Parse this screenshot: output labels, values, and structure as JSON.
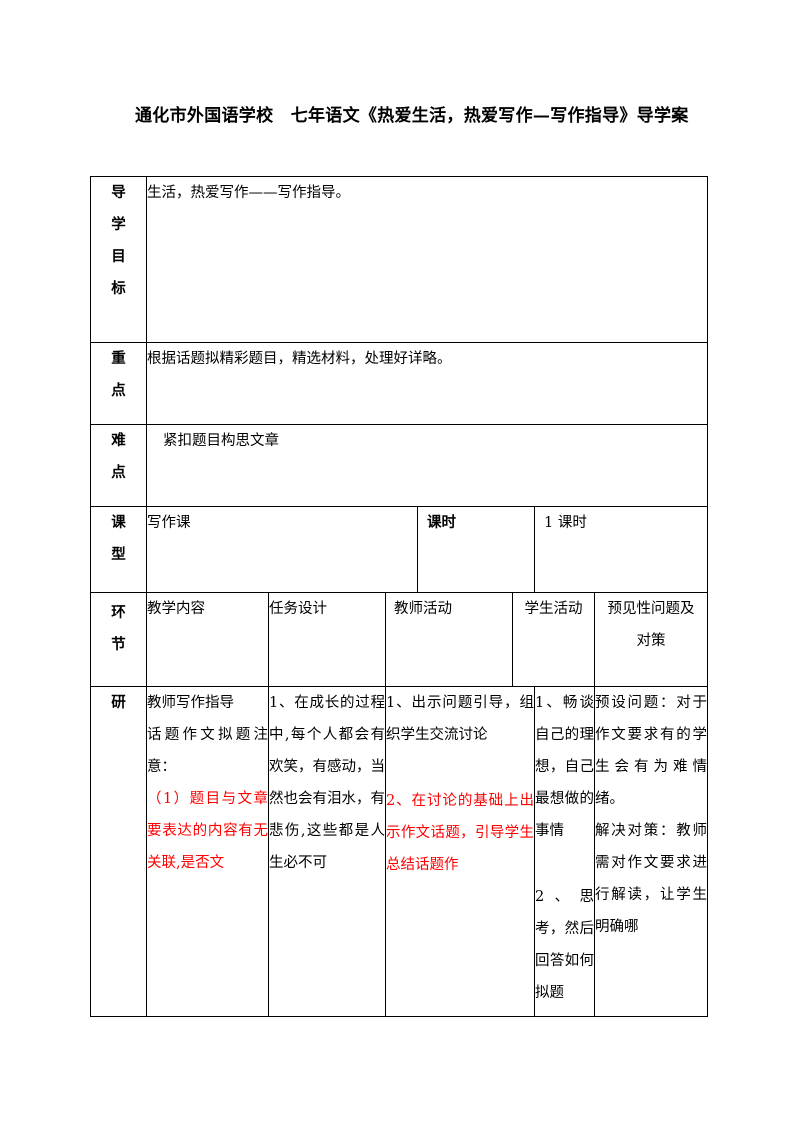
{
  "document": {
    "title": "通化市外国语学校　七年语文《热爱生活，热爱写作—写作指导》导学案"
  },
  "colors": {
    "highlight_red": "#ff0000",
    "text_black": "#000000",
    "border": "#000000"
  },
  "info_rows": [
    {
      "label": "导学目标",
      "label_chars": [
        "导",
        "学",
        "目",
        "标"
      ],
      "content": "生活，热爱写作——写作指导。"
    },
    {
      "label": "重点",
      "label_chars": [
        "重",
        "点"
      ],
      "content": "根据话题拟精彩题目，精选材料，处理好详略。"
    },
    {
      "label": "难点",
      "label_chars": [
        "难",
        "点"
      ],
      "content": "紧扣题目构思文章"
    }
  ],
  "lesson_row": {
    "type_label": "课型",
    "type_label_chars": [
      "课",
      "型"
    ],
    "type_value": "写作课",
    "periods_label": "课时",
    "periods_value": "1 课时"
  },
  "activity_table": {
    "headers": {
      "stage": "环节",
      "stage_chars": [
        "环",
        "节"
      ],
      "content": "教学内容",
      "task": "任务设计",
      "teacher": "教师活动",
      "student": "学生活动",
      "issues_line1": "预见性问题及",
      "issues_line2": "对策"
    },
    "rows": [
      {
        "stage": "研",
        "content": [
          {
            "text": "教师写作指导",
            "color": "black"
          },
          {
            "text": "话题作文拟题注意：",
            "color": "black"
          },
          {
            "text": "（1）题目与文章要表达的内容有无关联,是否文",
            "color": "red"
          }
        ],
        "task": [
          {
            "text": "1、在成长的过程中,每个人都会有欢笑，有感动，当然也会有泪水，有悲伤,这些都是人生必不可",
            "color": "black"
          }
        ],
        "teacher": [
          {
            "text": "1、出示问题引导，组织学生交流讨论",
            "color": "black"
          },
          {
            "text": "2、在讨论的基础上出示作文话题，引导学生总结话题作",
            "color": "red",
            "gap": true
          }
        ],
        "student": [
          {
            "text": "1、畅谈自己的理想，自己最想做的事情",
            "color": "black"
          },
          {
            "text": "2、思考，然后回答如何拟题",
            "color": "black",
            "gap": true
          }
        ],
        "issues": [
          {
            "text": "预设问题：对于作文要求有的学生会有为难情绪。",
            "color": "black"
          },
          {
            "text": "解决对策：教师需对作文要求进行解读，让学生明确哪",
            "color": "black"
          }
        ]
      }
    ]
  }
}
